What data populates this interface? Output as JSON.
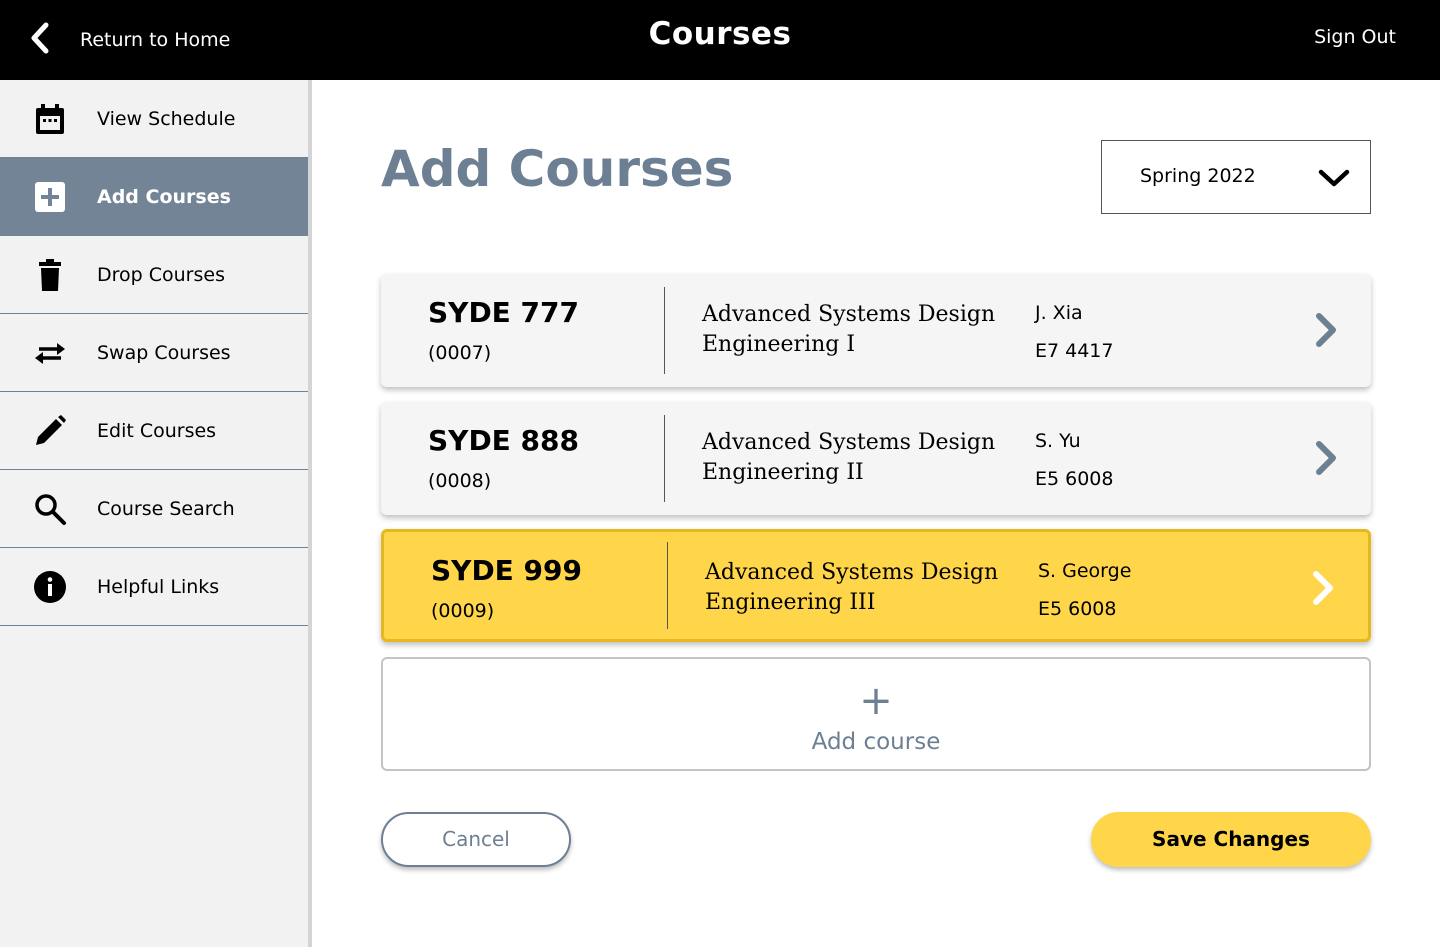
{
  "header": {
    "back_label": "Return to Home",
    "title": "Courses",
    "signout_label": "Sign Out"
  },
  "sidebar": {
    "items": [
      {
        "label": "View Schedule",
        "icon": "calendar-icon",
        "active": false
      },
      {
        "label": "Add Courses",
        "icon": "plus-box-icon",
        "active": true
      },
      {
        "label": "Drop Courses",
        "icon": "trash-icon",
        "active": false
      },
      {
        "label": "Swap Courses",
        "icon": "swap-arrows-icon",
        "active": false
      },
      {
        "label": "Edit Courses",
        "icon": "pencil-icon",
        "active": false
      },
      {
        "label": "Course Search",
        "icon": "search-icon",
        "active": false
      },
      {
        "label": "Helpful Links",
        "icon": "info-icon",
        "active": false
      }
    ]
  },
  "main": {
    "title": "Add Courses",
    "term": "Spring 2022",
    "courses": [
      {
        "code": "SYDE 777",
        "section": "(0007)",
        "name_line1": "Advanced Systems Design",
        "name_line2": "Engineering I",
        "instructor": "J. Xia",
        "room": "E7 4417",
        "selected": false
      },
      {
        "code": "SYDE 888",
        "section": "(0008)",
        "name_line1": "Advanced Systems Design",
        "name_line2": "Engineering II",
        "instructor": "S. Yu",
        "room": "E5 6008",
        "selected": false
      },
      {
        "code": "SYDE 999",
        "section": "(0009)",
        "name_line1": "Advanced Systems Design",
        "name_line2": "Engineering III",
        "instructor": "S. George",
        "room": "E5 6008",
        "selected": true
      }
    ],
    "add_course_label": "Add course",
    "cancel_label": "Cancel",
    "save_label": "Save Changes"
  },
  "colors": {
    "accent_yellow": "#ffd54a",
    "slate": "#6d7f92",
    "active_nav": "#738496"
  }
}
